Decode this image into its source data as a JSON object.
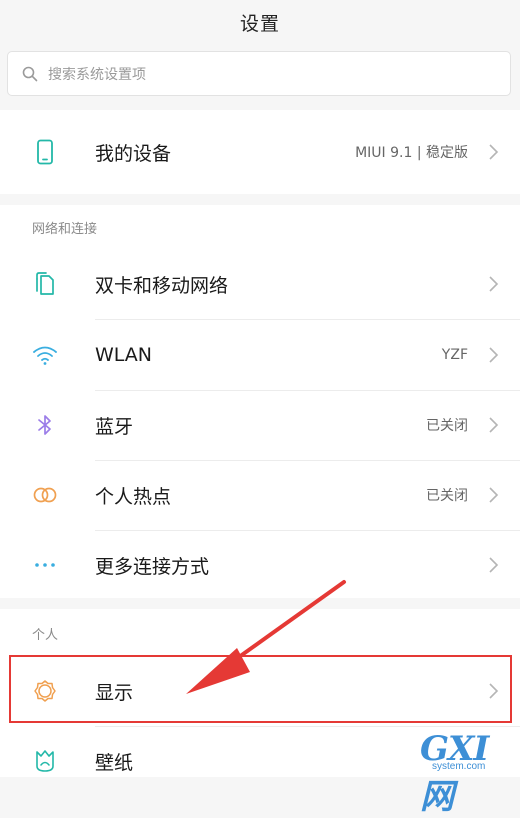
{
  "header": {
    "title": "设置"
  },
  "search": {
    "placeholder": "搜索系统设置项"
  },
  "device": {
    "label": "我的设备",
    "value": "MIUI 9.1 | 稳定版"
  },
  "sections": {
    "network": {
      "title": "网络和连接",
      "items": [
        {
          "label": "双卡和移动网络",
          "value": "",
          "icon": "dual-sim-icon"
        },
        {
          "label": "WLAN",
          "value": "YZF",
          "icon": "wifi-icon"
        },
        {
          "label": "蓝牙",
          "value": "已关闭",
          "icon": "bluetooth-icon"
        },
        {
          "label": "个人热点",
          "value": "已关闭",
          "icon": "hotspot-icon"
        },
        {
          "label": "更多连接方式",
          "value": "",
          "icon": "more-dots-icon"
        }
      ]
    },
    "personal": {
      "title": "个人",
      "items": [
        {
          "label": "显示",
          "value": "",
          "icon": "display-sun-icon"
        },
        {
          "label": "壁纸",
          "value": "",
          "icon": "wallpaper-icon"
        }
      ]
    }
  },
  "annotation": {
    "highlight_target": "显示",
    "arrow_color": "#e53935"
  },
  "watermark": {
    "text": "GXI网",
    "sub": "system.com"
  },
  "colors": {
    "accent_teal": "#23b8a8",
    "wifi_blue": "#3aaee0",
    "bluetooth_purple": "#9b7de8",
    "hotspot_orange": "#f0a050"
  }
}
